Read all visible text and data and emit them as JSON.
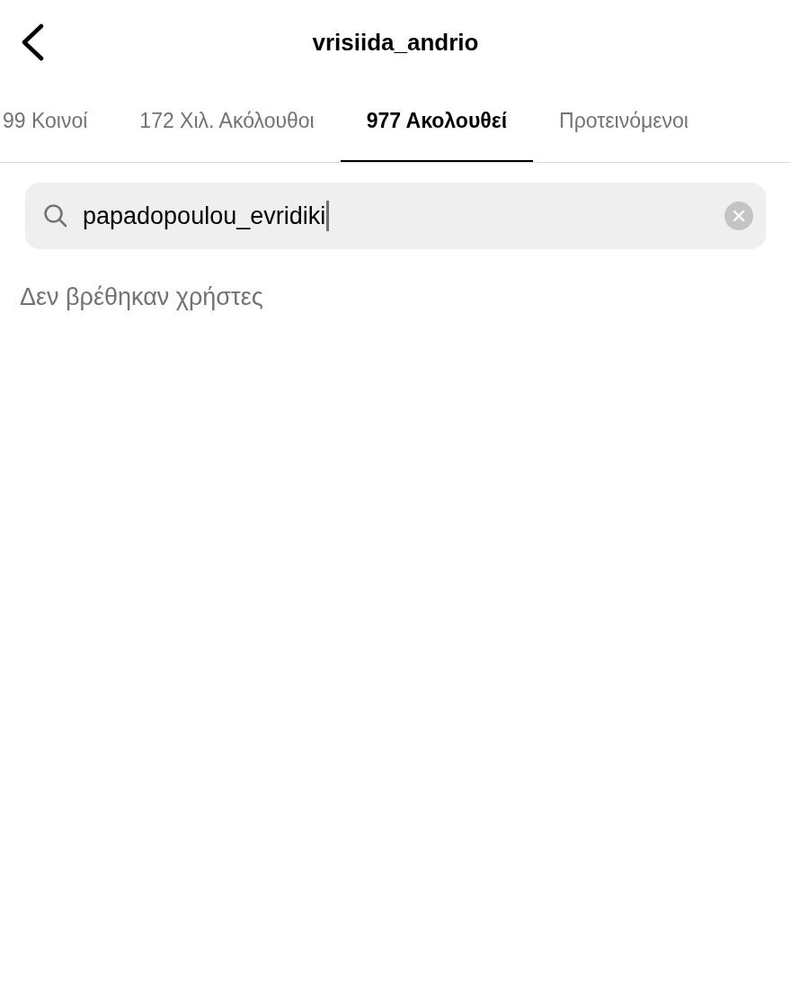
{
  "header": {
    "title": "vrisiida_andrio"
  },
  "tabs": [
    {
      "label": "99 Κοινοί",
      "selected": false
    },
    {
      "label": "172 Χιλ. Ακόλουθοι",
      "selected": false
    },
    {
      "label": "977 Ακολουθεί",
      "selected": true
    },
    {
      "label": "Προτεινόμενοι",
      "selected": false
    }
  ],
  "search": {
    "value": "papadopoulou_evridiki",
    "focused": true
  },
  "empty_message": "Δεν βρέθηκαν χρήστες"
}
